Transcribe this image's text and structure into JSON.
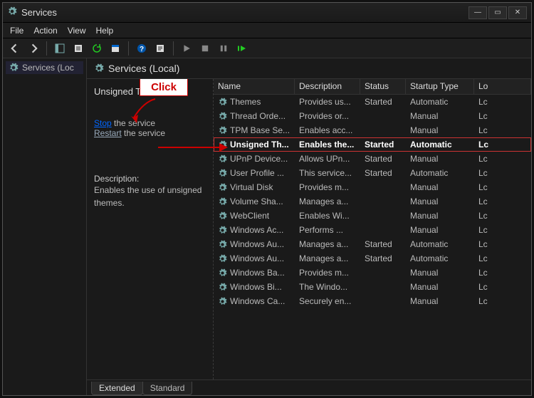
{
  "window": {
    "title": "Services"
  },
  "menu": {
    "file": "File",
    "action": "Action",
    "view": "View",
    "help": "Help"
  },
  "tree": {
    "root": "Services (Loc"
  },
  "main": {
    "heading": "Services (Local)"
  },
  "detail": {
    "service_name": "Unsigned T",
    "stop_label": "Stop",
    "stop_suffix": " the service",
    "restart_label": "Restart",
    "restart_suffix": " the service",
    "desc_heading": "Description:",
    "desc_text": "Enables the use of unsigned themes."
  },
  "callout": {
    "click": "Click"
  },
  "columns": {
    "name": "Name",
    "description": "Description",
    "status": "Status",
    "startup": "Startup Type",
    "logon": "Lo"
  },
  "services": [
    {
      "name": "Themes",
      "desc": "Provides us...",
      "status": "Started",
      "startup": "Automatic",
      "logon": "Lc"
    },
    {
      "name": "Thread Orde...",
      "desc": "Provides or...",
      "status": "",
      "startup": "Manual",
      "logon": "Lc"
    },
    {
      "name": "TPM Base Se...",
      "desc": "Enables acc...",
      "status": "",
      "startup": "Manual",
      "logon": "Lc"
    },
    {
      "name": "Unsigned Th...",
      "desc": "Enables the...",
      "status": "Started",
      "startup": "Automatic",
      "logon": "Lc",
      "selected": true
    },
    {
      "name": "UPnP Device...",
      "desc": "Allows UPn...",
      "status": "Started",
      "startup": "Manual",
      "logon": "Lc"
    },
    {
      "name": "User Profile ...",
      "desc": "This service...",
      "status": "Started",
      "startup": "Automatic",
      "logon": "Lc"
    },
    {
      "name": "Virtual Disk",
      "desc": "Provides m...",
      "status": "",
      "startup": "Manual",
      "logon": "Lc"
    },
    {
      "name": "Volume Sha...",
      "desc": "Manages a...",
      "status": "",
      "startup": "Manual",
      "logon": "Lc"
    },
    {
      "name": "WebClient",
      "desc": "Enables Wi...",
      "status": "",
      "startup": "Manual",
      "logon": "Lc"
    },
    {
      "name": "Windows Ac...",
      "desc": "Performs ...",
      "status": "",
      "startup": "Manual",
      "logon": "Lc"
    },
    {
      "name": "Windows Au...",
      "desc": "Manages a...",
      "status": "Started",
      "startup": "Automatic",
      "logon": "Lc"
    },
    {
      "name": "Windows Au...",
      "desc": "Manages a...",
      "status": "Started",
      "startup": "Automatic",
      "logon": "Lc"
    },
    {
      "name": "Windows Ba...",
      "desc": "Provides m...",
      "status": "",
      "startup": "Manual",
      "logon": "Lc"
    },
    {
      "name": "Windows Bi...",
      "desc": "The Windo...",
      "status": "",
      "startup": "Manual",
      "logon": "Lc"
    },
    {
      "name": "Windows Ca...",
      "desc": "Securely en...",
      "status": "",
      "startup": "Manual",
      "logon": "Lc"
    }
  ],
  "tabs": {
    "extended": "Extended",
    "standard": "Standard"
  }
}
